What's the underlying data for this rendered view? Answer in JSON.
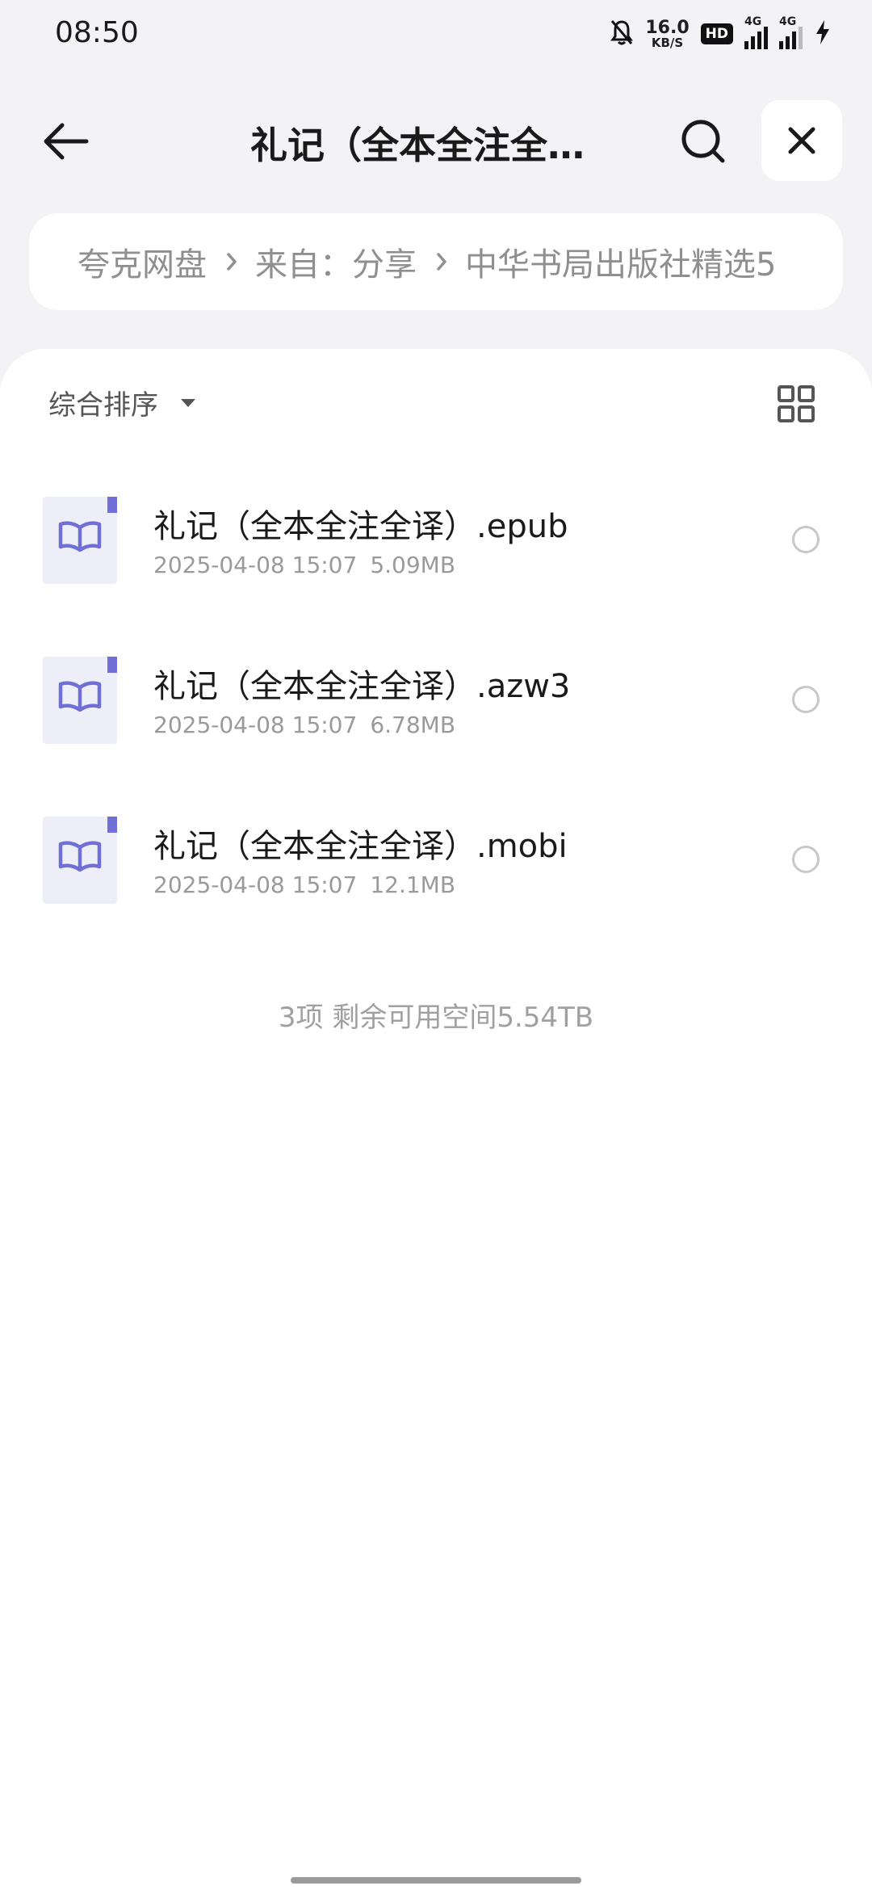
{
  "status_bar": {
    "time": "08:50",
    "net_speed_value": "16.0",
    "net_speed_unit": "KB/S",
    "hd_badge": "HD",
    "sim1_label": "4G",
    "sim2_label": "4G",
    "icons": [
      "bell-off-icon",
      "signal-icon",
      "charging-icon"
    ]
  },
  "header": {
    "title": "礼记（全本全注全…",
    "icons": [
      "back-arrow-icon",
      "search-icon",
      "close-icon"
    ]
  },
  "breadcrumb": {
    "items": [
      "夸克网盘",
      "来自：分享",
      "中华书局出版社精选5"
    ]
  },
  "toolbar": {
    "sort_label": "综合排序",
    "icons": [
      "dropdown-caret-icon",
      "grid-view-icon"
    ]
  },
  "files": [
    {
      "name": "礼记（全本全注全译）.epub",
      "date": "2025-04-08 15:07",
      "size": "5.09MB",
      "icon": "book-file-icon"
    },
    {
      "name": "礼记（全本全注全译）.azw3",
      "date": "2025-04-08 15:07",
      "size": "6.78MB",
      "icon": "book-file-icon"
    },
    {
      "name": "礼记（全本全注全译）.mobi",
      "date": "2025-04-08 15:07",
      "size": "12.1MB",
      "icon": "book-file-icon"
    }
  ],
  "footer": {
    "summary": "3项 剩余可用空间5.54TB"
  },
  "colors": {
    "background": "#f3f3f5",
    "panel": "#ffffff",
    "book_icon_accent": "#6f6fd6",
    "secondary_text": "#9a9a9a"
  }
}
